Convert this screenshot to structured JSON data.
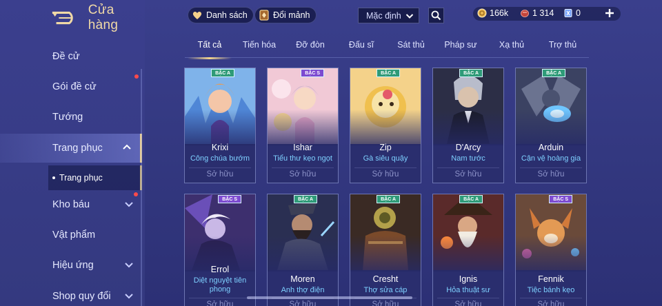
{
  "header": {
    "title": "Cửa hàng",
    "list_button": "Danh sách",
    "exchange_button": "Đổi mảnh",
    "sort_value": "Mặc định",
    "currencies": [
      {
        "icon": "gold-coin-icon",
        "value": "166k"
      },
      {
        "icon": "red-gem-icon",
        "value": "1 314"
      },
      {
        "icon": "voucher-icon",
        "value": "0"
      }
    ]
  },
  "sidebar": {
    "items": [
      {
        "label": "Đề cử"
      },
      {
        "label": "Gói đề cử",
        "badge": true
      },
      {
        "label": "Tướng"
      },
      {
        "label": "Trang phục",
        "expanded": true
      },
      {
        "label": "Kho báu",
        "badge": true
      },
      {
        "label": "Vật phẩm"
      },
      {
        "label": "Hiệu ứng"
      },
      {
        "label": "Shop quy đổi"
      }
    ],
    "sub_item": "Trang phục"
  },
  "tabs": [
    "Tất cả",
    "Tiến hóa",
    "Đỡ đòn",
    "Đấu sĩ",
    "Sát thủ",
    "Pháp sư",
    "Xạ thủ",
    "Trợ thủ"
  ],
  "active_tab": "Tất cả",
  "cards": [
    {
      "name": "Krixi",
      "skin": "Công chúa bướm",
      "tier": "BẬC A",
      "owned": "Sở hữu"
    },
    {
      "name": "Ishar",
      "skin": "Tiểu thư kẹo ngọt",
      "tier": "BẬC S",
      "owned": "Sở hữu"
    },
    {
      "name": "Zip",
      "skin": "Gà siêu quậy",
      "tier": "BẬC A",
      "owned": "Sở hữu"
    },
    {
      "name": "D'Arcy",
      "skin": "Nam tước",
      "tier": "BẬC A",
      "owned": "Sở hữu"
    },
    {
      "name": "Arduin",
      "skin": "Cận vệ hoàng gia",
      "tier": "BẬC A",
      "owned": "Sở hữu"
    },
    {
      "name": "Errol",
      "skin": "Diệt nguyệt tiên phong",
      "tier": "BẬC S",
      "owned": "Sở hữu"
    },
    {
      "name": "Moren",
      "skin": "Anh thợ điện",
      "tier": "BẬC A",
      "owned": "Sở hữu"
    },
    {
      "name": "Cresht",
      "skin": "Thợ sửa cáp",
      "tier": "BẬC A",
      "owned": "Sở hữu"
    },
    {
      "name": "Ignis",
      "skin": "Hỏa thuật sư",
      "tier": "BẬC A",
      "owned": "Sở hữu"
    },
    {
      "name": "Fennik",
      "skin": "Tiệc bánh kẹo",
      "tier": "BẬC S",
      "owned": "Sở hữu"
    }
  ],
  "colors": {
    "background": "#363b86",
    "accent_gold": "#f3d48c",
    "skin_text": "#7ed0ff",
    "tier_a": "#2f9b78",
    "tier_s": "#7d4bd0"
  }
}
